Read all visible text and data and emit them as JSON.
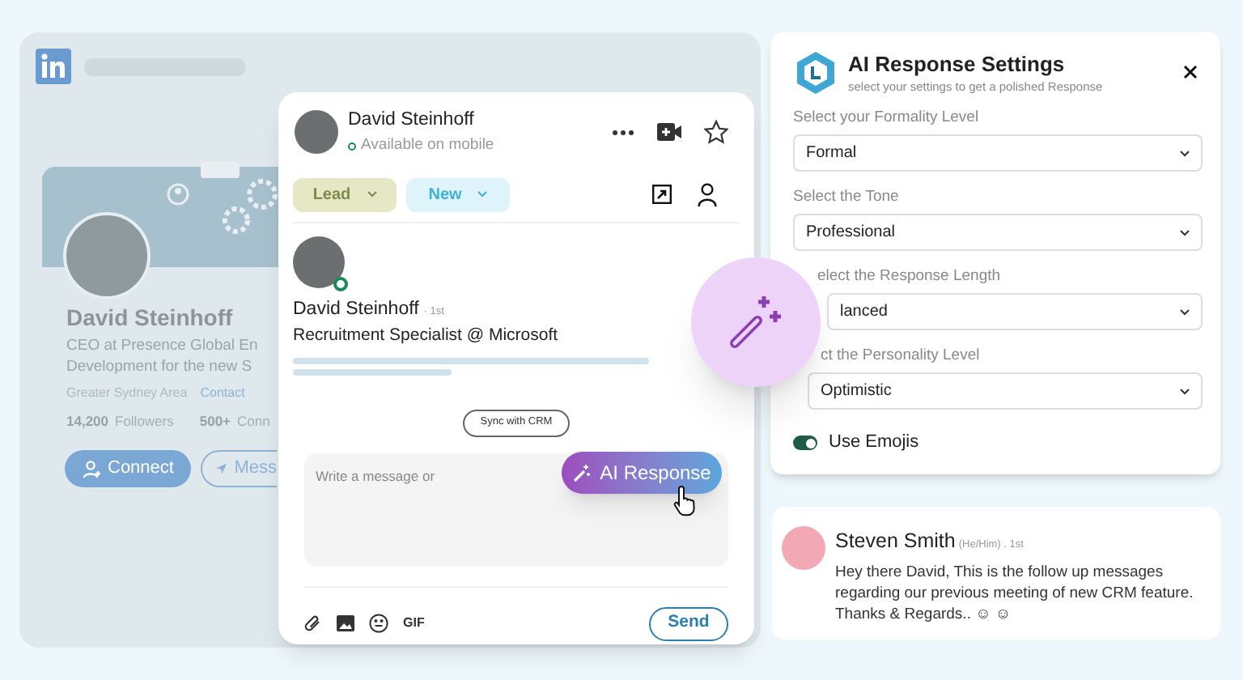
{
  "profile_card": {
    "name": "David Steinhoff",
    "headline": [
      "CEO at Presence Global En",
      "Development for the new S"
    ],
    "location": "Greater Sydney Area",
    "contact": "Contact",
    "followers_count": "14,200",
    "followers_label": "Followers",
    "connections_count": "500+",
    "connections_label": "Conn",
    "buttons": [
      {
        "kind": "filled",
        "label": "Connect"
      },
      {
        "kind": "outline",
        "label": "Mess"
      }
    ]
  },
  "chat": {
    "name": "David Steinhoff",
    "status": "Available on mobile",
    "tags": [
      {
        "label": "Lead",
        "color": "#e6e8c5"
      },
      {
        "label": "New",
        "color": "#dff3fb"
      }
    ],
    "contact": {
      "name": "David Steinhoff",
      "degree": "· 1st",
      "title": "Recruitment Specialist @ Microsoft",
      "online": true
    },
    "sync_button": "Sync with CRM",
    "message_placeholder": "Write a message or",
    "ai_button": "AI Response",
    "toolbar_text": "GIF",
    "send_button": "Send"
  },
  "settings": {
    "title": "AI Response Settings",
    "subtitle": "select your settings to get a polished Response",
    "fields": [
      {
        "label": "Select your Formality Level",
        "value": "Formal"
      },
      {
        "label": "Select the Tone",
        "value": "Professional"
      },
      {
        "label": "elect the Response Length",
        "value": "lanced"
      },
      {
        "label": "ct the Personality Level",
        "value": "Optimistic"
      }
    ],
    "toggle": {
      "label": "Use Emojis",
      "on": true
    }
  },
  "message": {
    "sender": "Steven Smith",
    "meta": "(He/Him) . 1st",
    "text": "Hey there David, This is the follow up messages regarding our previous meeting of new CRM feature. Thanks & Regards.. ☺ ☺"
  }
}
